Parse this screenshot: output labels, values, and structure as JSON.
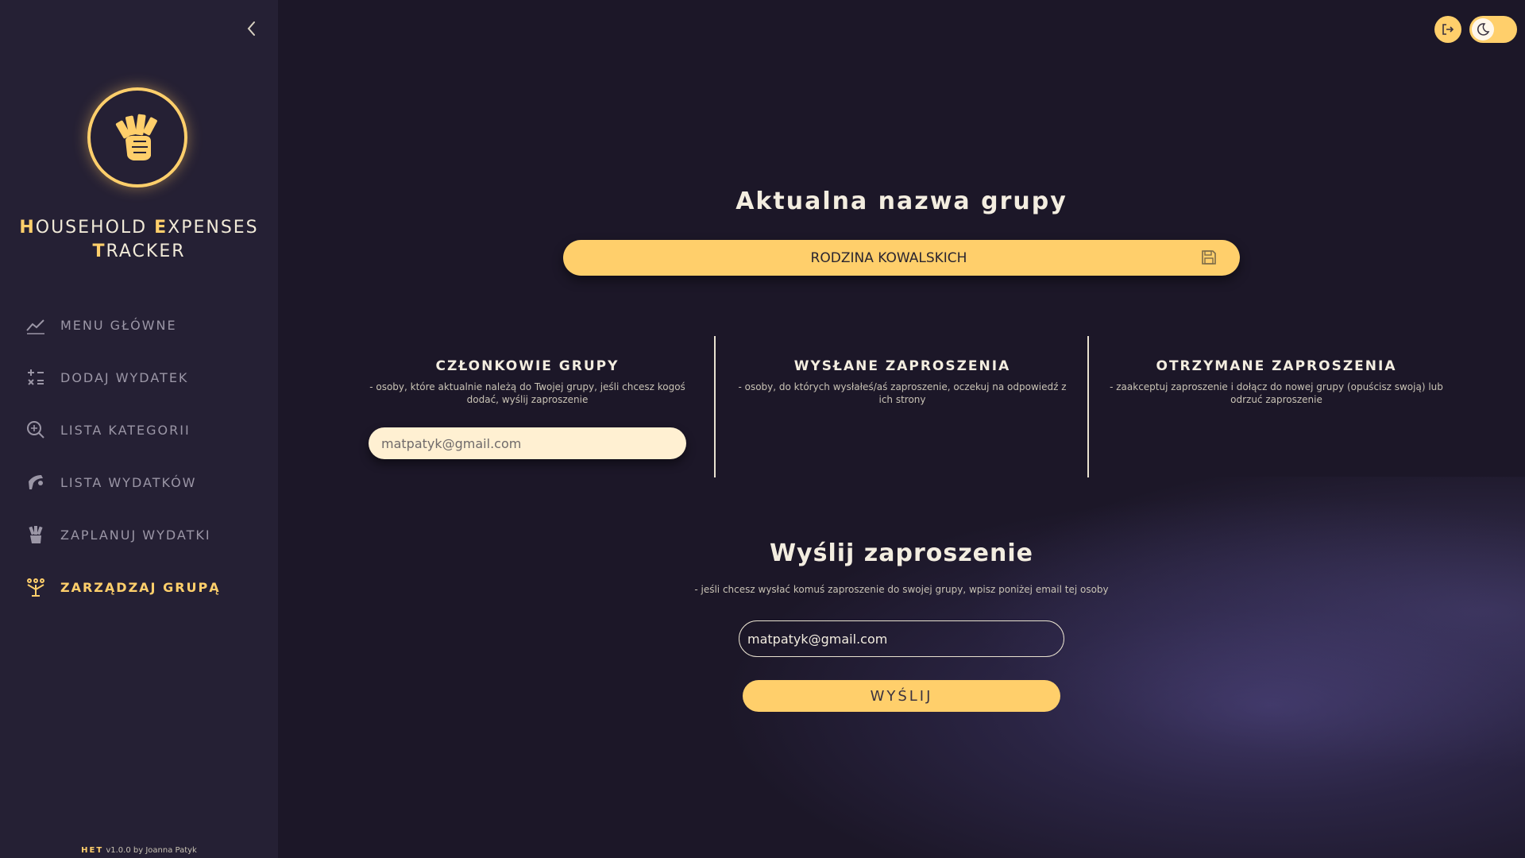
{
  "sidebar": {
    "title_parts": [
      {
        "first": "H",
        "rest": "OUSEHOLD "
      },
      {
        "first": "E",
        "rest": "XPENSES"
      },
      {
        "first": "T",
        "rest": "RACKER"
      }
    ],
    "items": [
      {
        "label": "MENU GŁÓWNE",
        "icon": "trend-chart-icon"
      },
      {
        "label": "DODAJ WYDATEK",
        "icon": "calculator-icon"
      },
      {
        "label": "LISTA KATEGORII",
        "icon": "search-plus-icon"
      },
      {
        "label": "LISTA WYDATKÓW",
        "icon": "dollar-hand-icon"
      },
      {
        "label": "ZAPLANUJ WYDATKI",
        "icon": "money-plan-icon"
      },
      {
        "label": "ZARZĄDZAJ GRUPĄ",
        "icon": "group-icon",
        "active": true
      }
    ],
    "footer_brand": "HET",
    "footer_text": "v1.0.0 by Joanna Patyk"
  },
  "main": {
    "group_heading": "Aktualna nazwa grupy",
    "group_name": "RODZINA KOWALSKICH",
    "columns": [
      {
        "title": "CZŁONKOWIE GRUPY",
        "desc": "- osoby, które aktualnie należą do Twojej grupy, jeśli chcesz kogoś dodać, wyślij zaproszenie",
        "members": [
          "matpatyk@gmail.com"
        ]
      },
      {
        "title": "WYSŁANE ZAPROSZENIA",
        "desc": "- osoby, do których wysłałeś/aś zaproszenie, oczekuj na odpowiedź z ich strony"
      },
      {
        "title": "OTRZYMANE ZAPROSZENIA",
        "desc": "- zaakceptuj zaproszenie i dołącz do nowej grupy (opuścisz swoją) lub odrzuć zaproszenie"
      }
    ],
    "invite_heading": "Wyślij zaproszenie",
    "invite_desc": "- jeśli chcesz wysłać komuś zaproszenie do swojej grupy, wpisz poniżej email tej osoby",
    "invite_email": "matpatyk@gmail.com",
    "send_label": "WYŚLIJ"
  },
  "colors": {
    "accent": "#ffcf6b",
    "background": "#1c1728",
    "sidebar": "#252034"
  }
}
